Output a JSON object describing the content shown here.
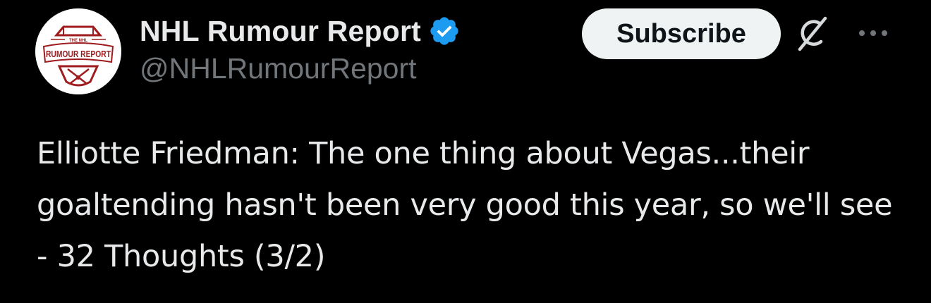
{
  "author": {
    "display_name": "NHL Rumour Report",
    "handle": "@NHLRumourReport",
    "verified": true,
    "verified_color": "#1d9bf0",
    "avatar": {
      "logo_top_text": "THE NHL",
      "logo_main_text": "RUMOUR REPORT",
      "logo_color": "#9e1b1e"
    }
  },
  "actions": {
    "subscribe_label": "Subscribe",
    "grok_icon": "grok-icon",
    "more_icon": "more-icon"
  },
  "tweet": {
    "text": "Elliotte Friedman: The one thing about Vegas...their goaltending hasn't been very good this year, so we'll see - 32 Thoughts (3/2)"
  },
  "colors": {
    "background": "#000000",
    "primary_text": "#e7e9ea",
    "secondary_text": "#71767b",
    "button_bg": "#eff3f4",
    "button_text": "#0f1419"
  }
}
